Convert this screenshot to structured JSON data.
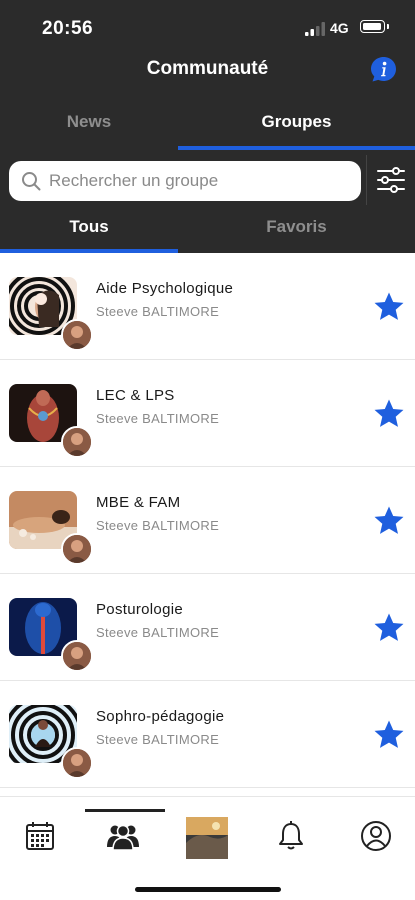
{
  "status_bar": {
    "time": "20:56",
    "network": "4G"
  },
  "header": {
    "title": "Communauté",
    "info_icon": "info-icon"
  },
  "top_tabs": [
    {
      "label": "News",
      "active": false
    },
    {
      "label": "Groupes",
      "active": true
    }
  ],
  "search": {
    "placeholder": "Rechercher un groupe",
    "value": "",
    "filter_icon": "filter-sliders-icon"
  },
  "sub_tabs": [
    {
      "label": "Tous",
      "active": true
    },
    {
      "label": "Favoris",
      "active": false
    }
  ],
  "groups": [
    {
      "name": "Aide Psychologique",
      "owner": "Steeve BALTIMORE",
      "favorite": true
    },
    {
      "name": "LEC & LPS",
      "owner": "Steeve BALTIMORE",
      "favorite": true
    },
    {
      "name": "MBE & FAM",
      "owner": "Steeve BALTIMORE",
      "favorite": true
    },
    {
      "name": "Posturologie",
      "owner": "Steeve BALTIMORE",
      "favorite": true
    },
    {
      "name": "Sophro-pédagogie",
      "owner": "Steeve BALTIMORE",
      "favorite": true
    }
  ],
  "bottom_nav": [
    {
      "icon": "calendar-icon",
      "active": false
    },
    {
      "icon": "people-group-icon",
      "active": true
    },
    {
      "icon": "home-photo-icon",
      "active": false
    },
    {
      "icon": "bell-icon",
      "active": false
    },
    {
      "icon": "profile-icon",
      "active": false
    }
  ],
  "colors": {
    "header_bg": "#2b2b2b",
    "accent": "#1f5fde",
    "star": "#1f5fde",
    "inactive_tab": "#8e8e8e"
  }
}
